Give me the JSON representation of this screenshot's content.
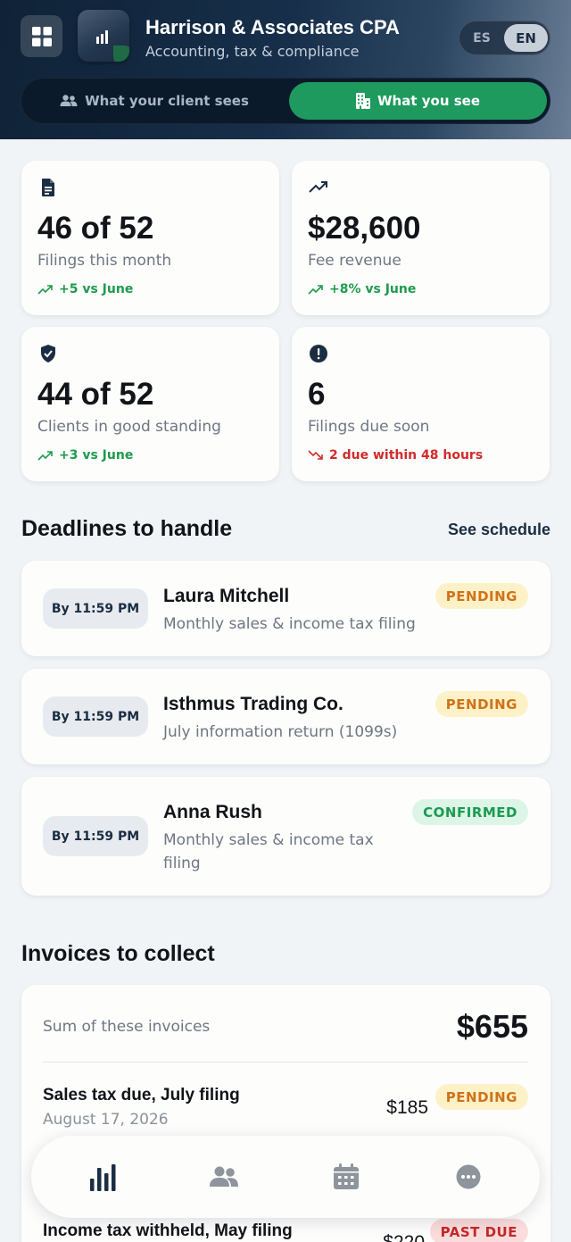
{
  "header": {
    "firm_name": "Harrison & Associates CPA",
    "firm_subtitle": "Accounting, tax & compliance",
    "languages": {
      "es": "ES",
      "en": "EN",
      "selected": "EN"
    },
    "view_toggle": {
      "client_label": "What your client sees",
      "self_label": "What you see",
      "selected": "self"
    }
  },
  "stats": [
    {
      "icon": "document-icon",
      "value": "46 of 52",
      "label": "Filings this month",
      "trend": "+5 vs June",
      "trend_dir": "up"
    },
    {
      "icon": "trending-up-icon",
      "value": "$28,600",
      "label": "Fee revenue",
      "trend": "+8% vs June",
      "trend_dir": "up"
    },
    {
      "icon": "shield-check-icon",
      "value": "44 of 52",
      "label": "Clients in good standing",
      "trend": "+3 vs June",
      "trend_dir": "up"
    },
    {
      "icon": "alert-circle-icon",
      "value": "6",
      "label": "Filings due soon",
      "trend": "2 due within 48 hours",
      "trend_dir": "down"
    }
  ],
  "deadlines": {
    "title": "Deadlines to handle",
    "link": "See schedule",
    "items": [
      {
        "time": "By 11:59 PM",
        "name": "Laura Mitchell",
        "desc": "Monthly sales & income tax filing",
        "status": "PENDING"
      },
      {
        "time": "By 11:59 PM",
        "name": "Isthmus Trading Co.",
        "desc": "July information return (1099s)",
        "status": "PENDING"
      },
      {
        "time": "By 11:59 PM",
        "name": "Anna Rush",
        "desc": "Monthly sales & income tax filing",
        "status": "CONFIRMED"
      }
    ]
  },
  "invoices": {
    "title": "Invoices to collect",
    "sum_label": "Sum of these invoices",
    "sum_value": "$655",
    "items": [
      {
        "title": "Sales tax due, July filing",
        "date": "August 17, 2026",
        "amount": "$185",
        "status": "PENDING"
      },
      {
        "title": "Income tax withheld, May filing",
        "date": "",
        "amount": "$220",
        "status": "PAST DUE"
      }
    ]
  },
  "nav": {
    "items": [
      "dashboard-icon",
      "clients-icon",
      "calendar-icon",
      "more-icon"
    ],
    "active": "dashboard-icon"
  },
  "colors": {
    "accent_green": "#1f9a5e",
    "navy": "#1b2d43",
    "trend_up": "#1f9a4d",
    "trend_down": "#d12b2b"
  }
}
